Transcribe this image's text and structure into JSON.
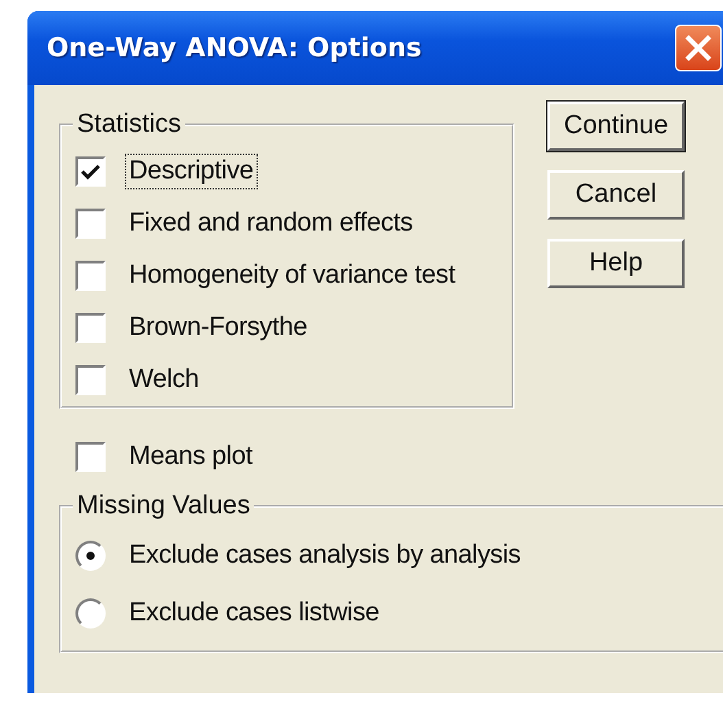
{
  "window": {
    "title": "One-Way ANOVA: Options"
  },
  "statistics": {
    "label": "Statistics",
    "items": [
      {
        "label": "Descriptive",
        "checked": true,
        "focused": true
      },
      {
        "label": "Fixed and random effects",
        "checked": false,
        "focused": false
      },
      {
        "label": "Homogeneity of variance test",
        "checked": false,
        "focused": false
      },
      {
        "label": "Brown-Forsythe",
        "checked": false,
        "focused": false
      },
      {
        "label": "Welch",
        "checked": false,
        "focused": false
      }
    ]
  },
  "means_plot": {
    "label": "Means plot",
    "checked": false
  },
  "missing_values": {
    "label": "Missing Values",
    "options": [
      {
        "label": "Exclude cases analysis by analysis",
        "selected": true
      },
      {
        "label": "Exclude cases listwise",
        "selected": false
      }
    ]
  },
  "buttons": [
    {
      "label": "Continue",
      "default": true
    },
    {
      "label": "Cancel",
      "default": false
    },
    {
      "label": "Help",
      "default": false
    }
  ]
}
